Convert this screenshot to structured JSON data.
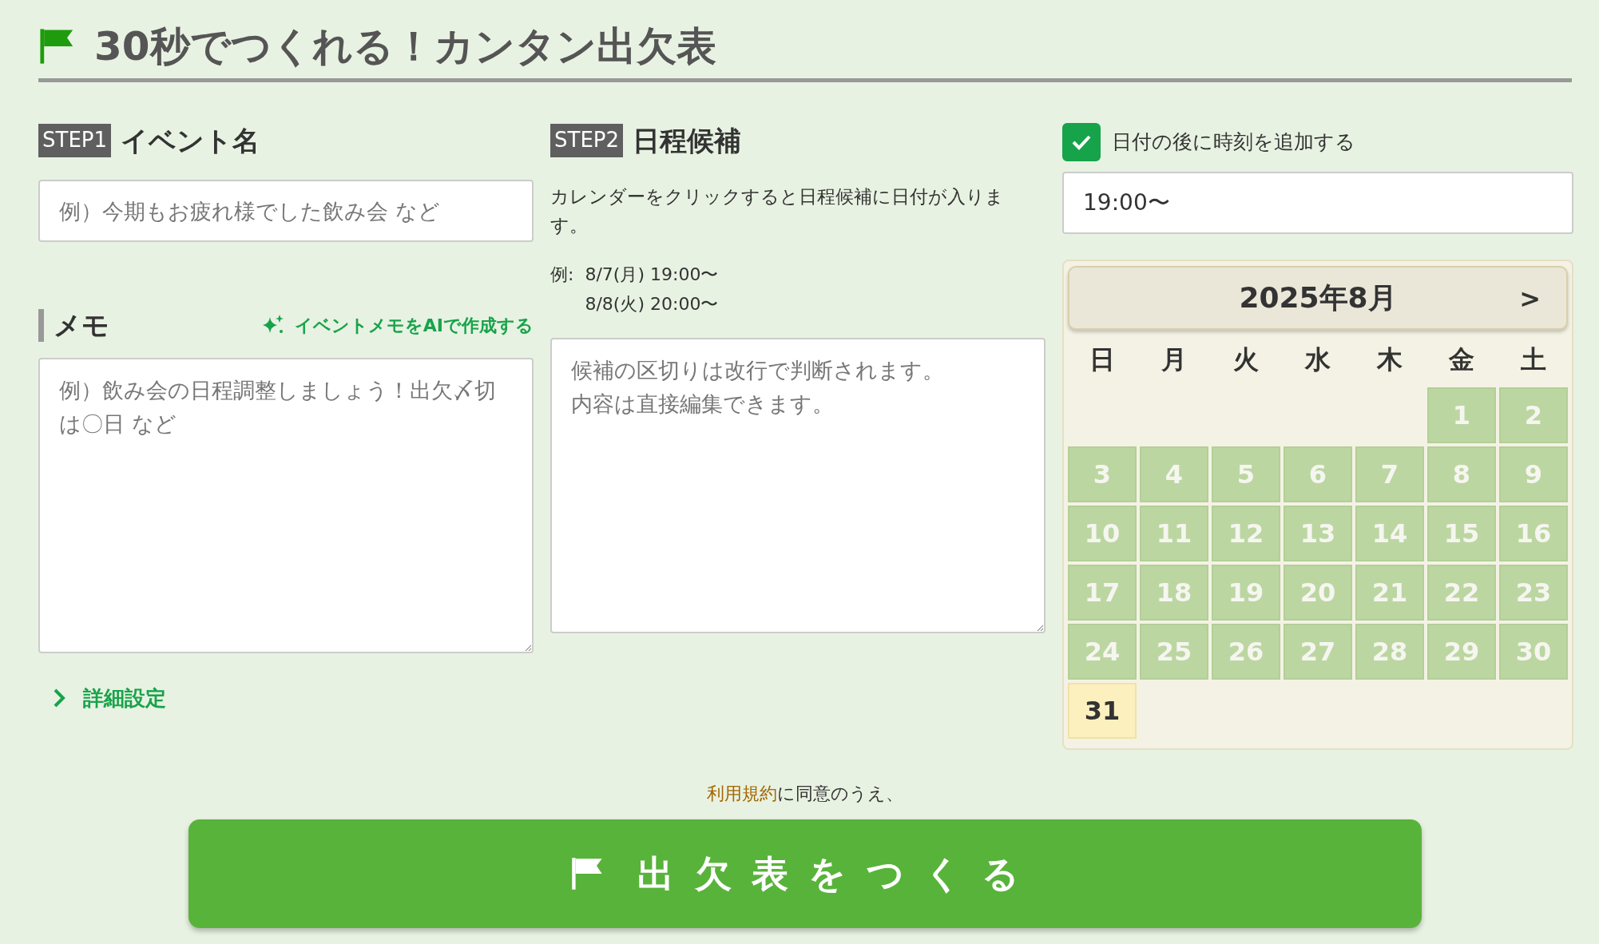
{
  "title": "30秒でつくれる！カンタン出欠表",
  "step1": {
    "badge": "STEP1",
    "heading": "イベント名",
    "placeholder": "例）今期もお疲れ様でした飲み会 など"
  },
  "memo": {
    "heading": "メモ",
    "ai_link": "イベントメモをAIで作成する",
    "placeholder": "例）飲み会の日程調整しましょう！出欠〆切は〇日 など"
  },
  "details_link": {
    "label": "詳細設定",
    "expanded": false
  },
  "step2": {
    "badge": "STEP2",
    "heading": "日程候補",
    "description": "カレンダーをクリックすると日程候補に日付が入ります。",
    "example_label": "例:",
    "example_lines": [
      "8/7(月) 19:00〜",
      "8/8(火) 20:00〜"
    ],
    "placeholder": [
      "候補の区切りは改行で判断されます。",
      "内容は直接編集できます。"
    ]
  },
  "time_option": {
    "label": "日付の後に時刻を追加する",
    "checked": true,
    "value": "19:00〜"
  },
  "calendar": {
    "month": "2025年8月",
    "next": ">",
    "weekdays": [
      "日",
      "月",
      "火",
      "水",
      "木",
      "金",
      "土"
    ],
    "weeks": [
      [
        {
          "day": "1",
          "today": false
        },
        {
          "day": "2",
          "today": false
        }
      ],
      [
        {
          "day": "3",
          "today": false
        },
        {
          "day": "4",
          "today": false
        },
        {
          "day": "5",
          "today": false
        },
        {
          "day": "6",
          "today": false
        },
        {
          "day": "7",
          "today": false
        },
        {
          "day": "8",
          "today": false
        },
        {
          "day": "9",
          "today": false
        }
      ],
      [
        {
          "day": "10",
          "today": false
        },
        {
          "day": "11",
          "today": false
        },
        {
          "day": "12",
          "today": false
        },
        {
          "day": "13",
          "today": false
        },
        {
          "day": "14",
          "today": false
        },
        {
          "day": "15",
          "today": false
        },
        {
          "day": "16",
          "today": false
        }
      ],
      [
        {
          "day": "17",
          "today": false
        },
        {
          "day": "18",
          "today": false
        },
        {
          "day": "19",
          "today": false
        },
        {
          "day": "20",
          "today": false
        },
        {
          "day": "21",
          "today": false
        },
        {
          "day": "22",
          "today": false
        },
        {
          "day": "23",
          "today": false
        }
      ],
      [
        {
          "day": "24",
          "today": false
        },
        {
          "day": "25",
          "today": false
        },
        {
          "day": "26",
          "today": false
        },
        {
          "day": "27",
          "today": false
        },
        {
          "day": "28",
          "today": false
        },
        {
          "day": "29",
          "today": false
        },
        {
          "day": "30",
          "today": false
        }
      ],
      [
        {
          "day": "31",
          "today": true
        }
      ]
    ]
  },
  "agreement": {
    "terms_link": "利用規約",
    "text": "に同意のうえ、"
  },
  "submit": "出欠表をつくる"
}
